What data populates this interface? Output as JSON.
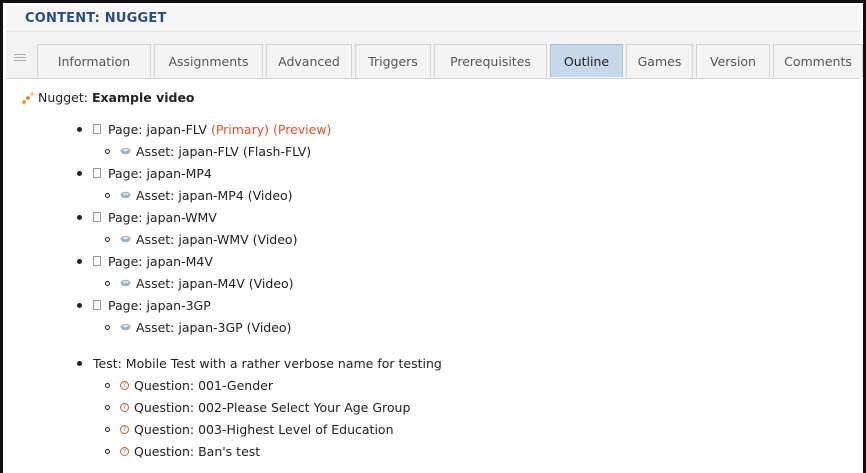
{
  "header": {
    "title": "CONTENT: NUGGET"
  },
  "tabs": [
    {
      "label": "Information"
    },
    {
      "label": "Assignments"
    },
    {
      "label": "Advanced"
    },
    {
      "label": "Triggers"
    },
    {
      "label": "Prerequisites"
    },
    {
      "label": "Outline",
      "active": true
    },
    {
      "label": "Games"
    },
    {
      "label": "Version"
    },
    {
      "label": "Comments"
    }
  ],
  "nugget": {
    "prefix": "Nugget:",
    "name": "Example video"
  },
  "pages": [
    {
      "label": "Page: japan-FLV",
      "primary": "(Primary)",
      "preview": "(Preview)",
      "asset": "Asset: japan-FLV (Flash-FLV)"
    },
    {
      "label": "Page: japan-MP4",
      "asset": "Asset: japan-MP4 (Video)"
    },
    {
      "label": "Page: japan-WMV",
      "asset": "Asset: japan-WMV (Video)"
    },
    {
      "label": "Page: japan-M4V",
      "asset": "Asset: japan-M4V (Video)"
    },
    {
      "label": "Page: japan-3GP",
      "asset": "Asset: japan-3GP (Video)"
    }
  ],
  "test": {
    "label": "Test: Mobile Test with a rather verbose name for testing",
    "questions": [
      {
        "label": "Question: 001-Gender"
      },
      {
        "label": "Question: 002-Please Select Your Age Group"
      },
      {
        "label": "Question: 003-Highest Level of Education"
      },
      {
        "label": "Question: Ban's test"
      }
    ]
  },
  "colors": {
    "accent_title": "#2a4e7a",
    "active_tab": "#c6d9ea",
    "link_orange": "#e0512c"
  },
  "icons": {
    "list": "list-icon",
    "nugget": "nugget-icon",
    "page": "page-icon",
    "asset": "asset-icon",
    "question": "question-icon"
  }
}
